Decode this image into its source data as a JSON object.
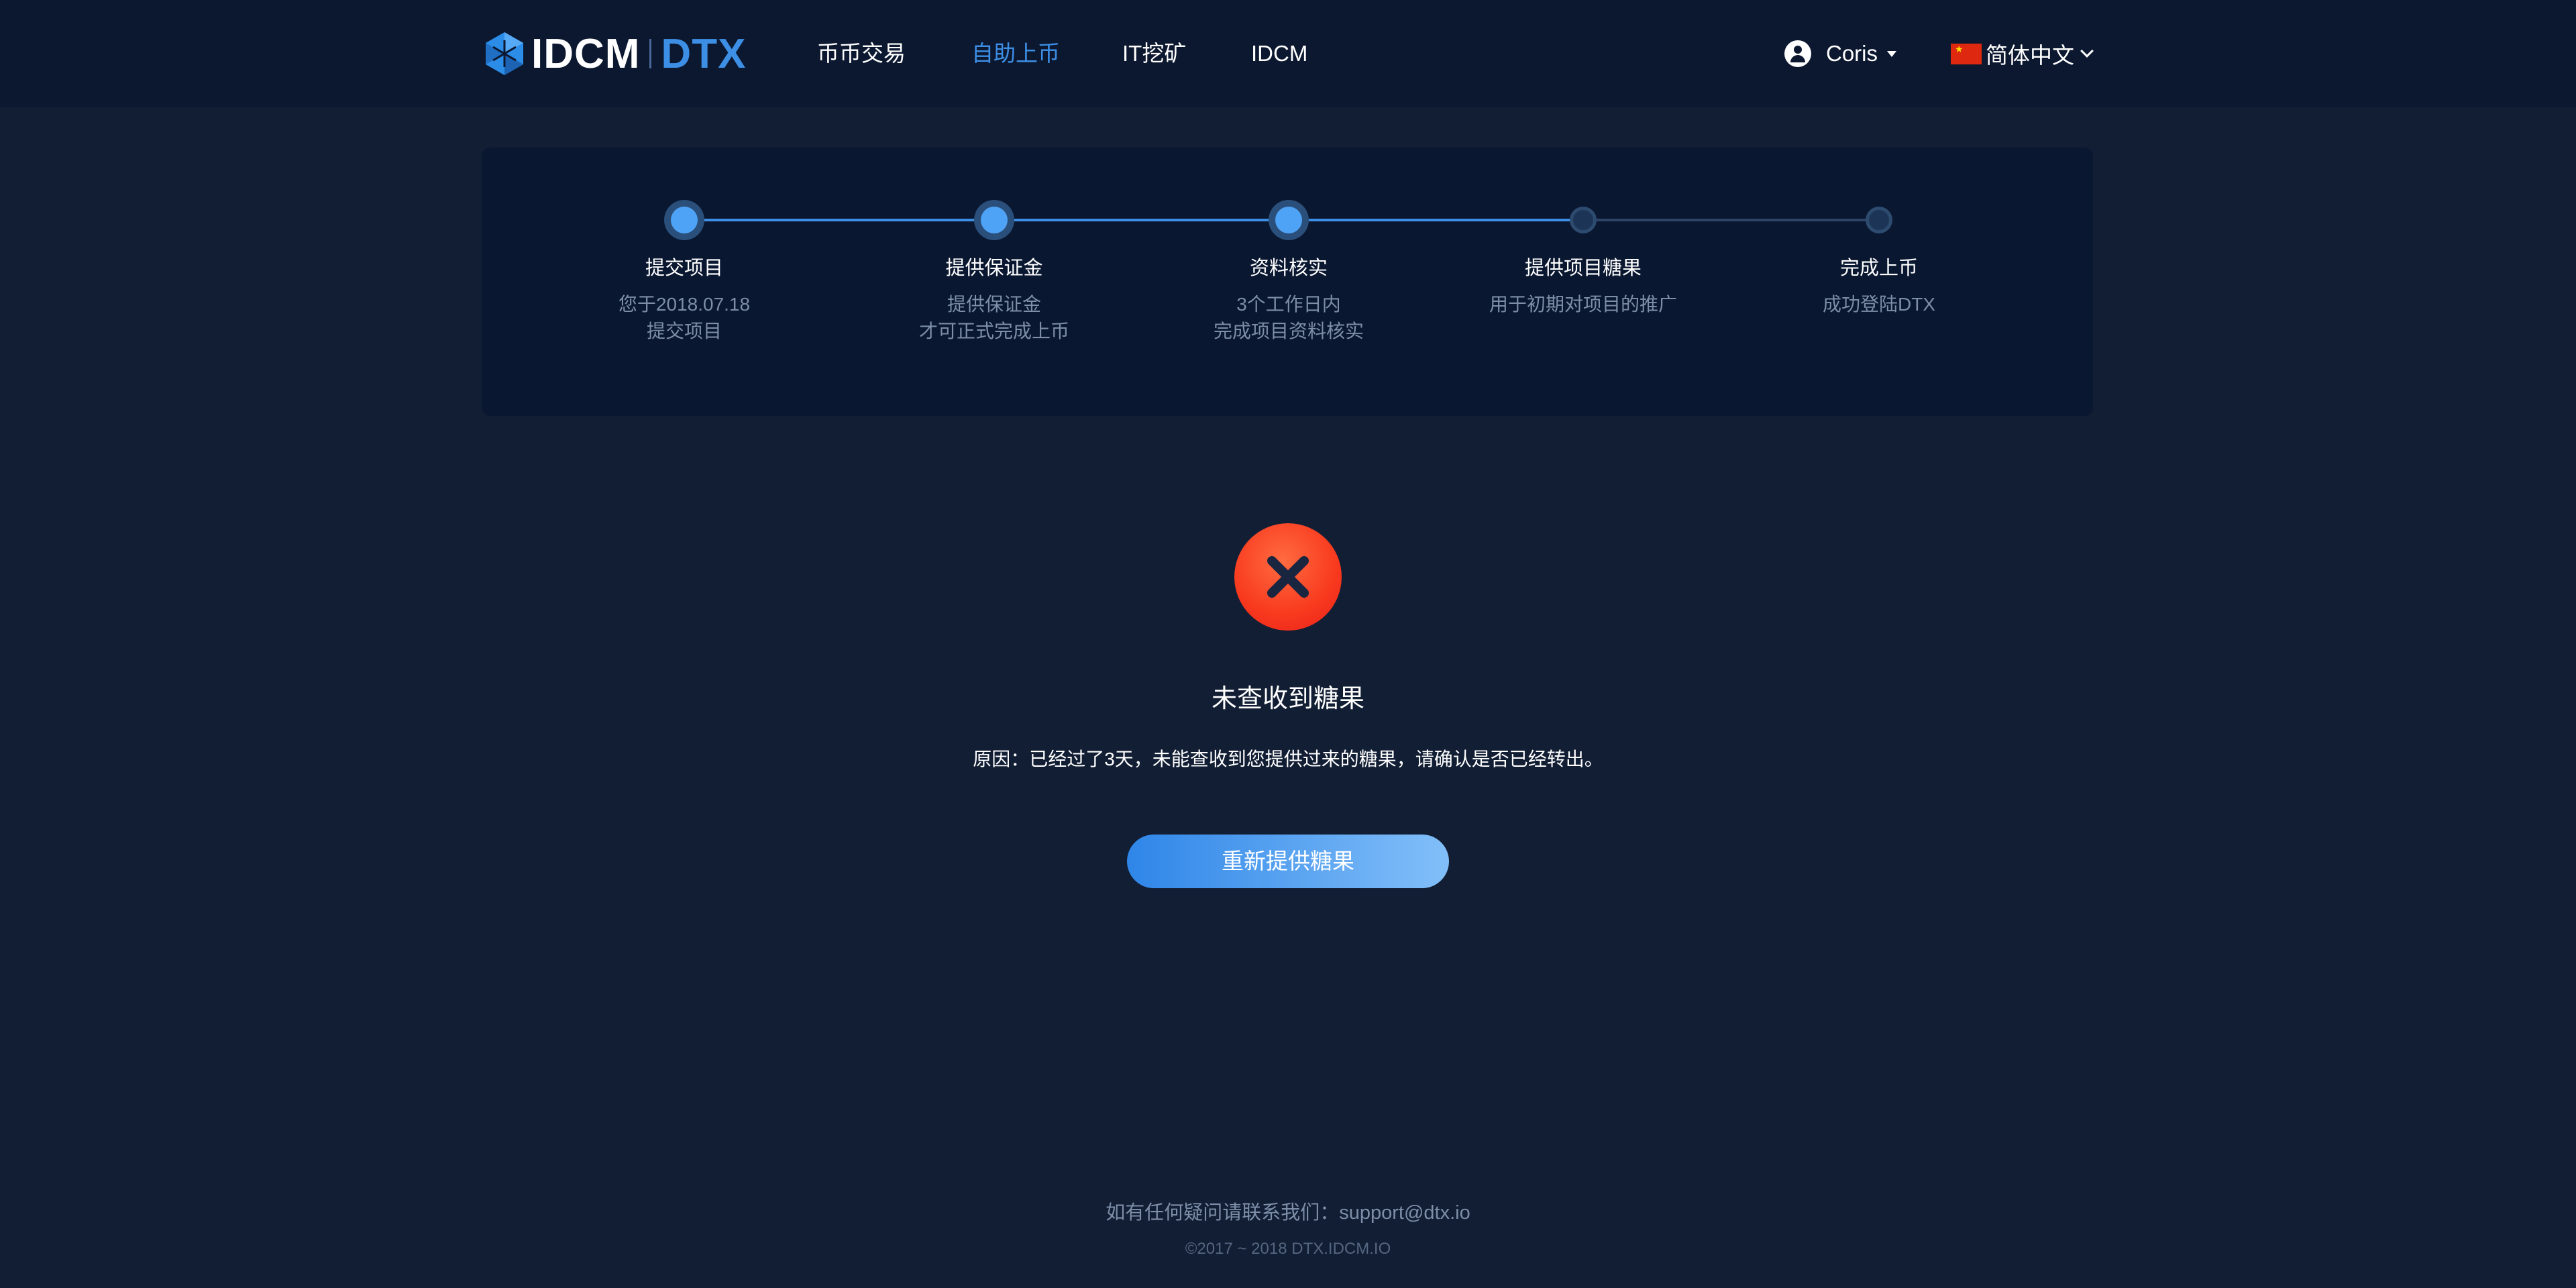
{
  "header": {
    "logo": {
      "brand": "IDCM",
      "product": "DTX"
    },
    "nav": [
      {
        "label": "币币交易",
        "active": false
      },
      {
        "label": "自助上币",
        "active": true
      },
      {
        "label": "IT挖矿",
        "active": false
      },
      {
        "label": "IDCM",
        "active": false
      }
    ],
    "user": {
      "name": "Coris",
      "avatar_icon": "user-circle-icon",
      "dropdown_icon": "caret-down-icon"
    },
    "language": {
      "label": "简体中文",
      "flag_icon": "china-flag-icon",
      "dropdown_icon": "chevron-down-icon"
    }
  },
  "steps": [
    {
      "title": "提交项目",
      "desc_line1": "您于2018.07.18",
      "desc_line2": "提交项目",
      "status": "done"
    },
    {
      "title": "提供保证金",
      "desc_line1": "提供保证金",
      "desc_line2": "才可正式完成上币",
      "status": "done"
    },
    {
      "title": "资料核实",
      "desc_line1": "3个工作日内",
      "desc_line2": "完成项目资料核实",
      "status": "done"
    },
    {
      "title": "提供项目糖果",
      "desc_line1": "用于初期对项目的推广",
      "desc_line2": "",
      "status": "pending"
    },
    {
      "title": "完成上币",
      "desc_line1": "成功登陆DTX",
      "desc_line2": "",
      "status": "pending"
    }
  ],
  "result": {
    "icon": "error-x-icon",
    "title": "未查收到糖果",
    "reason": "原因：已经过了3天，未能查收到您提供过来的糖果，请确认是否已经转出。",
    "button_label": "重新提供糖果"
  },
  "footer": {
    "contact": "如有任何疑问请联系我们：support@dtx.io",
    "copyright": "©2017 ~ 2018 DTX.IDCM.IO"
  },
  "colors": {
    "page_bg": "#121e34",
    "header_bg": "#0c1830",
    "card_bg": "#0a1730",
    "accent": "#3d8fe6",
    "error": "#f8391e"
  }
}
